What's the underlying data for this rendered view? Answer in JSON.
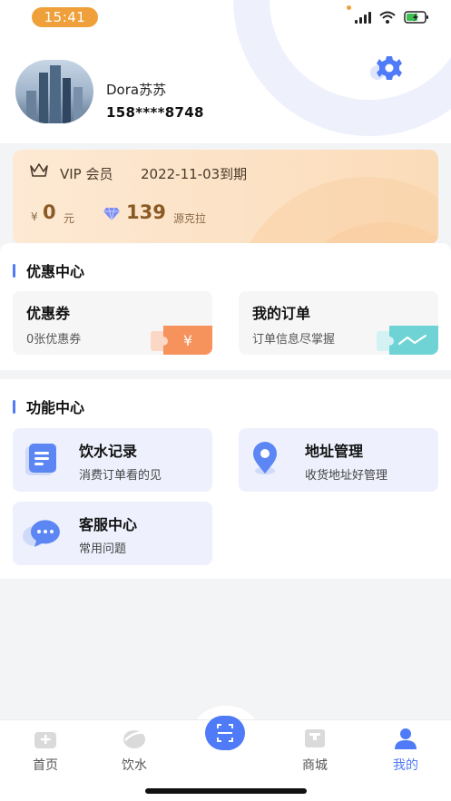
{
  "status_bar": {
    "time": "15:41"
  },
  "profile": {
    "name": "Dora苏苏",
    "phone": "158****8748"
  },
  "vip": {
    "label": "VIP 会员",
    "expire": "2022-11-03到期",
    "currency_symbol": "¥",
    "balance": "0",
    "balance_unit": "元",
    "points": "139",
    "points_unit": "源克拉"
  },
  "discount_center": {
    "title": "优惠中心",
    "tiles": [
      {
        "title": "优惠券",
        "subtitle": "0张优惠券",
        "art_symbol": "¥"
      },
      {
        "title": "我的订单",
        "subtitle": "订单信息尽掌握"
      }
    ]
  },
  "function_center": {
    "title": "功能中心",
    "tiles": [
      {
        "title": "饮水记录",
        "subtitle": "消费订单看的见",
        "icon": "document-icon"
      },
      {
        "title": "地址管理",
        "subtitle": "收货地址好管理",
        "icon": "location-pin-icon"
      },
      {
        "title": "客服中心",
        "subtitle": "常用问题",
        "icon": "chat-bubble-icon"
      }
    ]
  },
  "tab_bar": {
    "items": [
      {
        "label": "首页",
        "icon": "home-icon"
      },
      {
        "label": "饮水",
        "icon": "water-icon"
      },
      {
        "label": "",
        "icon": "scan-icon"
      },
      {
        "label": "商城",
        "icon": "shop-icon"
      },
      {
        "label": "我的",
        "icon": "profile-icon",
        "active": true
      }
    ],
    "active_color": "#4f7af8"
  },
  "colors": {
    "accent": "#4f7af8",
    "vip_text": "#8a5a25",
    "time_pill": "#f0a03a"
  }
}
